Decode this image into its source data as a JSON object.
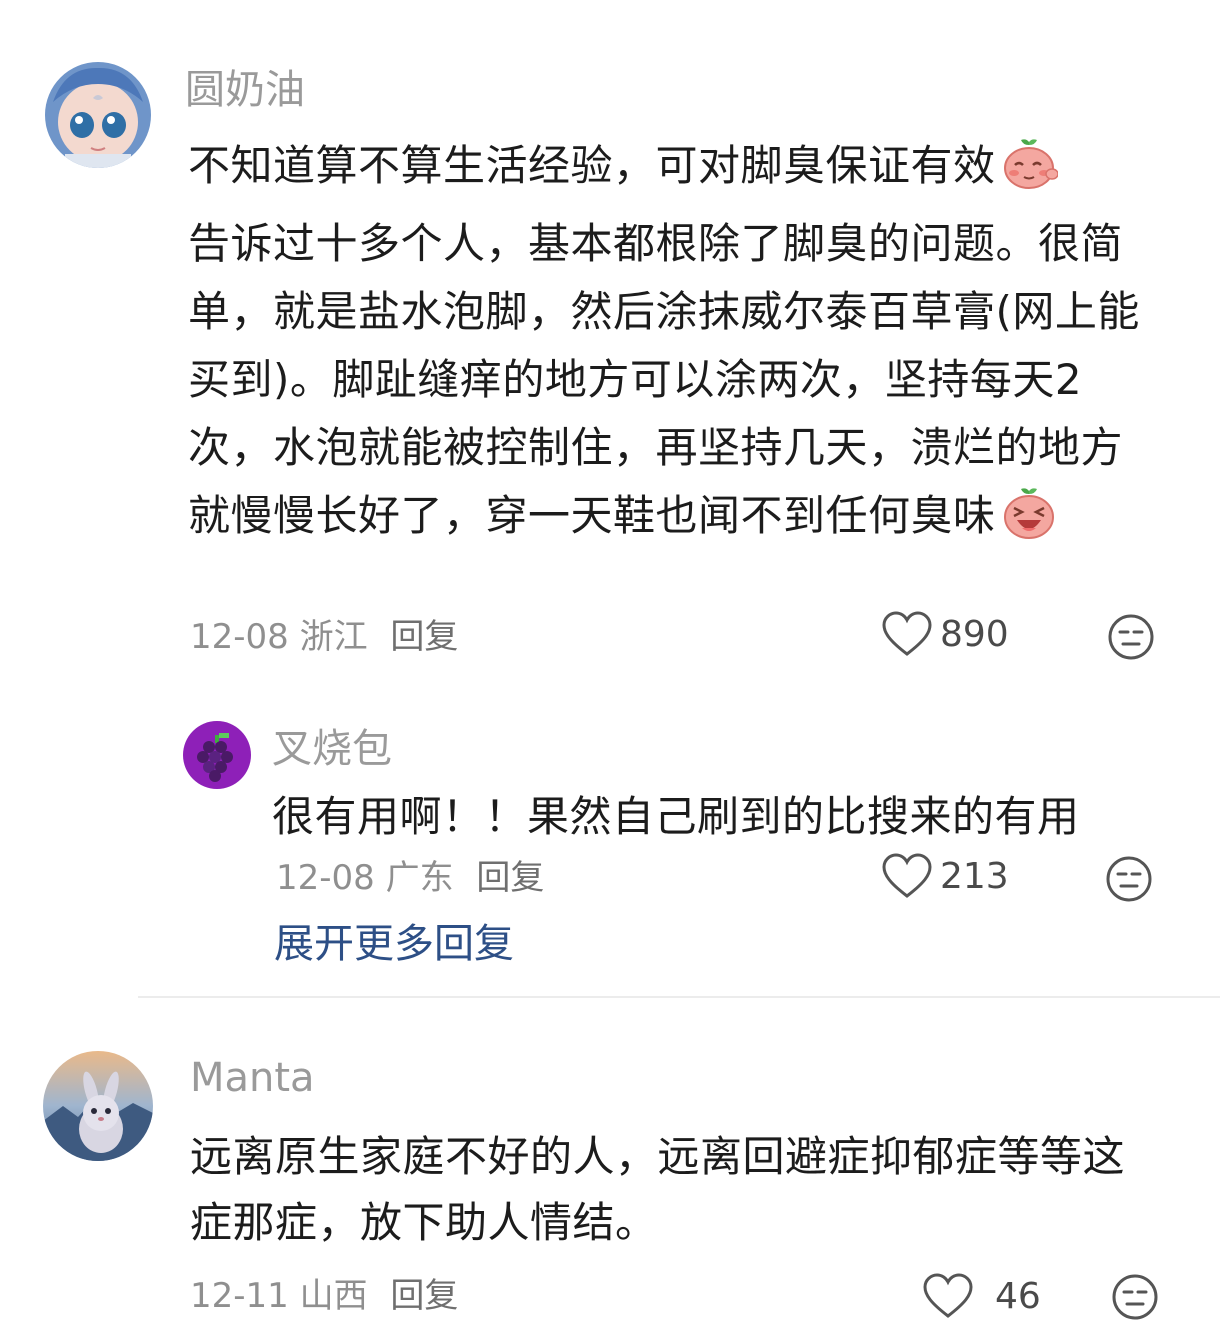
{
  "comments": [
    {
      "username": "圆奶油",
      "text": "不知道算不算生活经验，可对脚臭保证有效",
      "text2": "告诉过十多个人，基本都根除了脚臭的问题。很简单，就是盐水泡脚，然后涂抹威尔泰百草膏(网上能买到)。脚趾缝痒的地方可以涂两次，坚持每天2次，水泡就能被控制住，再坚持几天，溃烂的地方就慢慢长好了，穿一天鞋也闻不到任何臭味",
      "date": "12-08",
      "location": "浙江",
      "reply_label": "回复",
      "likes": "890",
      "icons": {
        "emoji_1": "blushing-peach-emoji-icon",
        "emoji_2": "laughing-peach-emoji-icon"
      }
    },
    {
      "username": "叉烧包",
      "text": "很有用啊！！果然自己刷到的比搜来的有用",
      "date": "12-08",
      "location": "广东",
      "reply_label": "回复",
      "likes": "213"
    },
    {
      "username": "Manta",
      "text": "远离原生家庭不好的人，远离回避症抑郁症等等这症那症，放下助人情结。",
      "date": "12-11",
      "location": "山西",
      "reply_label": "回复",
      "likes": "46"
    }
  ],
  "expand_replies_label": "展开更多回复",
  "colors": {
    "username": "#9a9a9a",
    "body": "#1c1c1c",
    "meta": "#8f8f8f",
    "expand_link": "#2d4f86"
  }
}
